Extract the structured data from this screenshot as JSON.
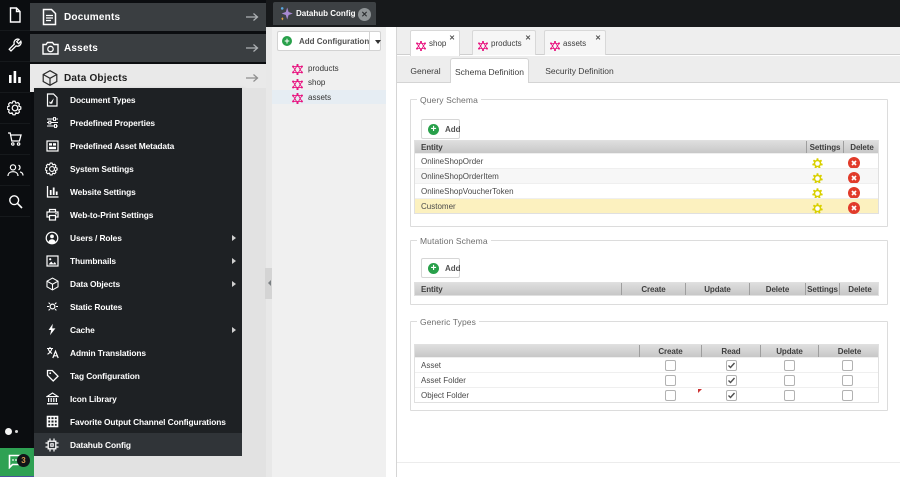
{
  "iconbar": {
    "icons": [
      "file",
      "wrench",
      "bar-chart",
      "gear",
      "cart",
      "users",
      "search"
    ],
    "chat": {
      "badge": "3"
    }
  },
  "sidebar": {
    "headers": [
      {
        "label": "Documents",
        "icon": "file-text"
      },
      {
        "label": "Assets",
        "icon": "camera"
      },
      {
        "label": "Data Objects",
        "icon": "cube",
        "active": true
      }
    ],
    "items": [
      {
        "label": "Document Types",
        "icon": "page-edit"
      },
      {
        "label": "Predefined Properties",
        "icon": "sliders"
      },
      {
        "label": "Predefined Asset Metadata",
        "icon": "metadata"
      },
      {
        "label": "System Settings",
        "icon": "gear"
      },
      {
        "label": "Website Settings",
        "icon": "chart"
      },
      {
        "label": "Web-to-Print Settings",
        "icon": "printer"
      },
      {
        "label": "Users / Roles",
        "icon": "user",
        "submenu": true
      },
      {
        "label": "Thumbnails",
        "icon": "image",
        "submenu": true
      },
      {
        "label": "Data Objects",
        "icon": "cube",
        "submenu": true
      },
      {
        "label": "Static Routes",
        "icon": "route"
      },
      {
        "label": "Cache",
        "icon": "bolt",
        "submenu": true
      },
      {
        "label": "Admin Translations",
        "icon": "translate"
      },
      {
        "label": "Tag Configuration",
        "icon": "tag"
      },
      {
        "label": "Icon Library",
        "icon": "bank"
      },
      {
        "label": "Favorite Output Channel Configurations",
        "icon": "grid"
      },
      {
        "label": "Datahub Config",
        "icon": "chip",
        "active": true
      }
    ]
  },
  "window_tab": {
    "title": "Datahub Config",
    "icon": "sparkle",
    "close": "x"
  },
  "tree_panel": {
    "add_button": {
      "label": "Add Configuration"
    },
    "items": [
      {
        "label": "products",
        "icon": "graphql"
      },
      {
        "label": "shop",
        "icon": "graphql"
      },
      {
        "label": "assets",
        "icon": "graphql",
        "highlighted": true
      }
    ]
  },
  "main": {
    "tabs": [
      {
        "label": "shop",
        "active": true
      },
      {
        "label": "products"
      },
      {
        "label": "assets"
      }
    ],
    "subtabs": [
      {
        "label": "General"
      },
      {
        "label": "Schema Definition",
        "active": true
      },
      {
        "label": "Security Definition"
      }
    ],
    "query_schema": {
      "legend": "Query Schema",
      "add_label": "Add",
      "columns": [
        "Entity",
        "Settings",
        "Delete"
      ],
      "rows": [
        {
          "entity": "OnlineShopOrder"
        },
        {
          "entity": "OnlineShopOrderItem"
        },
        {
          "entity": "OnlineShopVoucherToken"
        },
        {
          "entity": "Customer",
          "highlighted": true
        }
      ]
    },
    "mutation_schema": {
      "legend": "Mutation Schema",
      "add_label": "Add",
      "columns": [
        "Entity",
        "Create",
        "Update",
        "Delete",
        "Settings",
        "Delete"
      ],
      "rows": []
    },
    "generic_types": {
      "legend": "Generic Types",
      "columns": [
        "",
        "Create",
        "Read",
        "Update",
        "Delete"
      ],
      "rows": [
        {
          "label": "Asset",
          "create": false,
          "read": true,
          "update": false,
          "delete": false
        },
        {
          "label": "Asset Folder",
          "create": false,
          "read": true,
          "update": false,
          "delete": false
        },
        {
          "label": "Object Folder",
          "create": false,
          "read": true,
          "update": false,
          "delete": false,
          "dirty": "read"
        }
      ]
    }
  },
  "colors": {
    "magenta": "#e5067e",
    "green": "#28a04a",
    "gear_yellow": "#d9d000",
    "delete_red": "#e13b2a",
    "row_highlight": "#fcf1bf",
    "chat_green": "#2ea153"
  }
}
